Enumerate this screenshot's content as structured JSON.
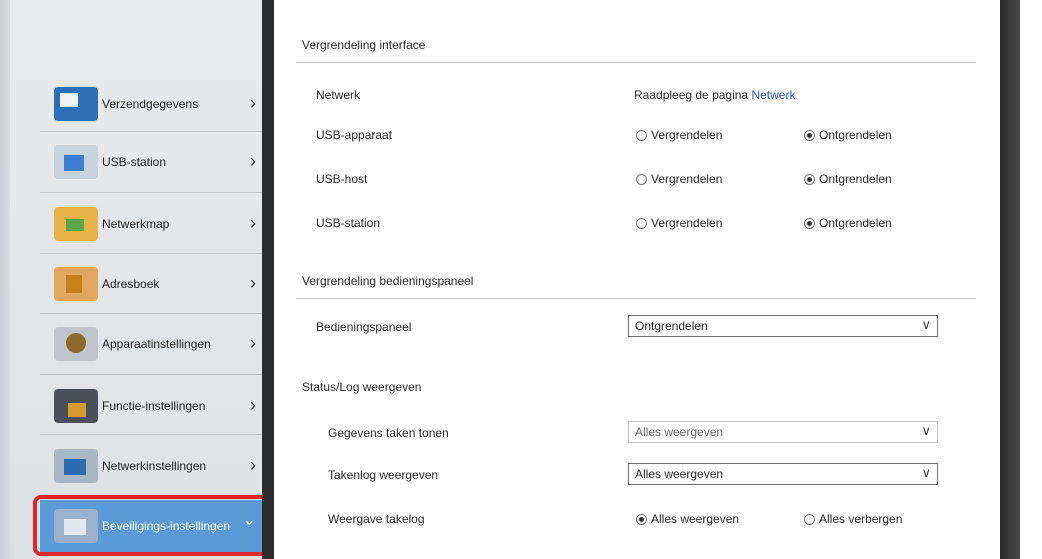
{
  "sidebar": {
    "items": [
      {
        "label": "Verzendgegevens",
        "icon": "document-send-icon"
      },
      {
        "label": "USB-station",
        "icon": "usb-drive-icon"
      },
      {
        "label": "Netwerkmap",
        "icon": "network-folder-icon"
      },
      {
        "label": "Adresboek",
        "icon": "address-book-icon"
      },
      {
        "label": "Apparaatinstellingen",
        "icon": "device-settings-icon"
      },
      {
        "label": "Functie-instellingen",
        "icon": "function-settings-icon"
      },
      {
        "label": "Netwerkinstellingen",
        "icon": "network-settings-icon"
      },
      {
        "label": "Beveiligings-instellingen",
        "icon": "security-settings-icon"
      }
    ],
    "chevron": "›",
    "selected_chevron": "⌄"
  },
  "content": {
    "interface_section": {
      "title": "Vergrendeling interface",
      "network_label": "Netwerk",
      "network_text": "Raadpleeg de pagina",
      "network_link": "Netwerk",
      "rows": [
        {
          "label": "USB-apparaat",
          "option_a": "Vergrendelen",
          "option_b": "Ontgrendelen",
          "selected": "b"
        },
        {
          "label": "USB-host",
          "option_a": "Vergrendelen",
          "option_b": "Ontgrendelen",
          "selected": "b"
        },
        {
          "label": "USB-station",
          "option_a": "Vergrendelen",
          "option_b": "Ontgrendelen",
          "selected": "b"
        }
      ]
    },
    "operation_section": {
      "title": "Vergrendeling bedieningspaneel",
      "rows": [
        {
          "label": "Bedieningspaneel",
          "value": "Ontgrendelen"
        }
      ]
    },
    "status_section": {
      "title": "Status/Log weergeven",
      "rows": [
        {
          "label": "Gegevens taken tonen",
          "value": "Alles weergeven"
        },
        {
          "label": "Takenlog weergeven",
          "value": "Alles weergeven"
        }
      ],
      "display_row": {
        "label": "Weergave takelog",
        "option_a": "Alles weergeven",
        "option_b": "Alles verbergen",
        "selected": "a"
      }
    },
    "dropdown_arrow": "∨"
  }
}
